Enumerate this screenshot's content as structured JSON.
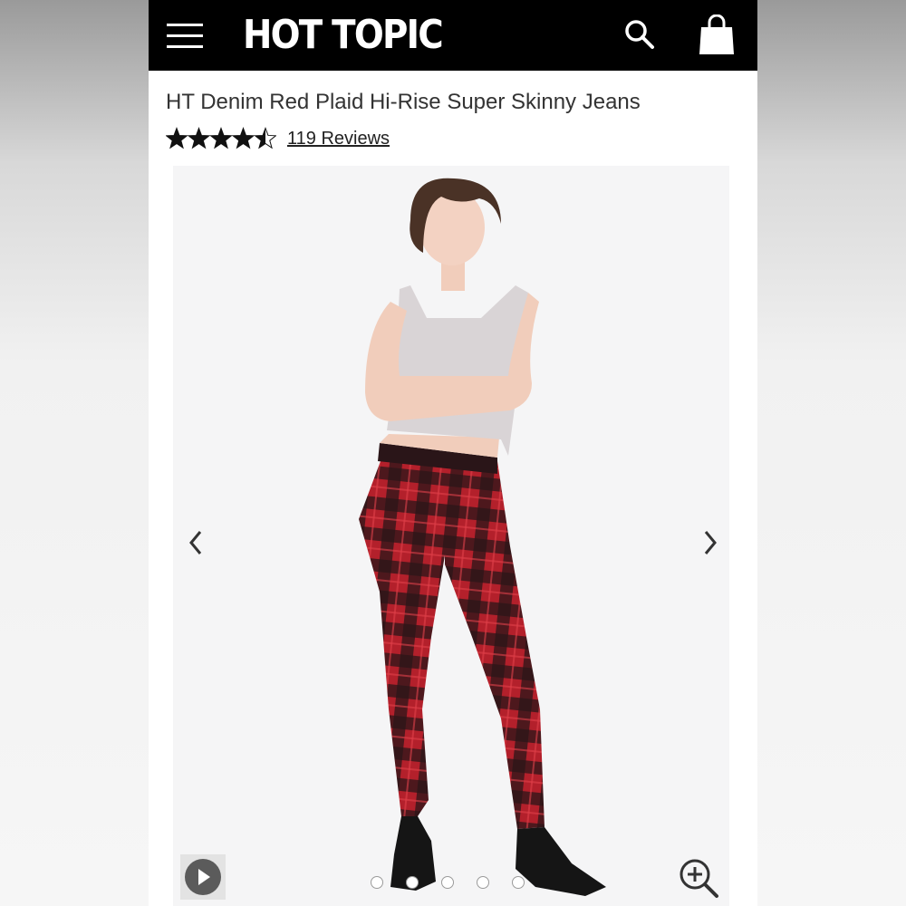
{
  "header": {
    "logo_text": "HOT TOPIC",
    "menu_icon": "hamburger-menu-icon",
    "search_icon": "search-icon",
    "bag_icon": "shopping-bag-icon",
    "background_color": "#000000"
  },
  "product": {
    "title": "HT Denim Red Plaid Hi-Rise Super Skinny Jeans",
    "rating": 4.5,
    "max_rating": 5,
    "reviews_label": "119 Reviews"
  },
  "gallery": {
    "prev_icon": "chevron-left-icon",
    "next_icon": "chevron-right-icon",
    "video_icon": "play-icon",
    "zoom_icon": "zoom-in-icon",
    "dot_count": 5,
    "active_dot": 1
  },
  "colors": {
    "plaid_red": "#b3202b",
    "plaid_dark": "#1c1416",
    "top_color": "#d9d4d6",
    "text": "#333333"
  }
}
